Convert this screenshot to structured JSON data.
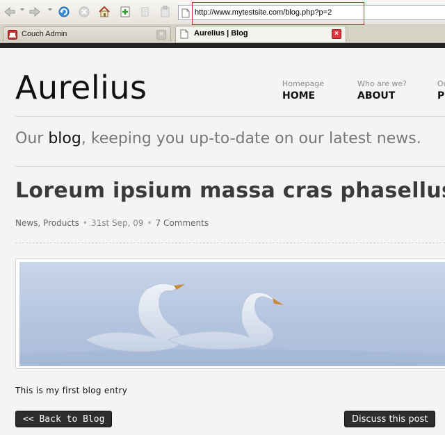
{
  "browser": {
    "url": "http://www.mytestsite.com/blog.php?p=2",
    "tabs": [
      {
        "label": "Couch Admin",
        "active": false
      },
      {
        "label": "Aurelius | Blog",
        "active": true
      }
    ],
    "tab_close_glyph": "×"
  },
  "site": {
    "title": "Aurelius",
    "nav": [
      {
        "sub": "Homepage",
        "label": "HOME"
      },
      {
        "sub": "Who are we?",
        "label": "ABOUT"
      },
      {
        "sub": "Our",
        "label": "PO"
      }
    ],
    "tagline": {
      "prefix": "Our ",
      "emphasis": "blog",
      "suffix": ", keeping you up-to-date on our latest news."
    }
  },
  "post": {
    "title": "Loreum ipsium massa cras phasellus",
    "categories": "News, Products",
    "separator": "•",
    "date": "31st Sep, 09",
    "comments": "7 Comments",
    "body": "This is my first blog entry"
  },
  "actions": {
    "back_label": "<< Back to Blog",
    "discuss_label": "Discuss this post"
  },
  "colors": {
    "accent_dark": "#2d2d2d",
    "url_highlight": "#d02a2a",
    "active_tab_close": "#d9363e"
  }
}
